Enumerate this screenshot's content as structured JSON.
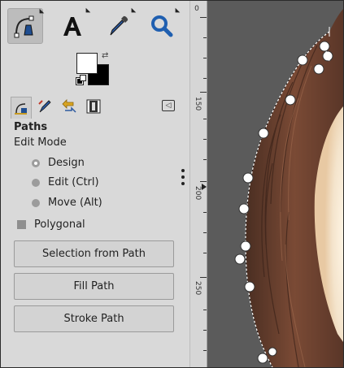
{
  "toolbox": {
    "tools": [
      {
        "name": "paths-tool-icon",
        "active": true
      },
      {
        "name": "text-tool-icon",
        "active": false
      },
      {
        "name": "color-picker-icon",
        "active": false
      },
      {
        "name": "zoom-tool-icon",
        "active": false
      }
    ],
    "foreground_color": "#ffffff",
    "background_color": "#000000"
  },
  "dock_tabs": [
    {
      "name": "tool-options-tab-icon",
      "active": true
    },
    {
      "name": "device-status-tab-icon",
      "active": false
    },
    {
      "name": "undo-history-tab-icon",
      "active": false
    },
    {
      "name": "images-tab-icon",
      "active": false
    }
  ],
  "tool_options": {
    "title": "Paths",
    "edit_mode_label": "Edit Mode",
    "modes": [
      {
        "label": "Design",
        "selected": true
      },
      {
        "label": "Edit (Ctrl)",
        "selected": false
      },
      {
        "label": "Move (Alt)",
        "selected": false
      }
    ],
    "polygonal_label": "Polygonal",
    "polygonal_checked": false,
    "buttons": {
      "selection_from_path": "Selection from Path",
      "fill_path": "Fill Path",
      "stroke_path": "Stroke Path"
    }
  },
  "ruler": {
    "labels": [
      "0",
      "150",
      "200",
      "250"
    ]
  },
  "colors": {
    "canvas_bg": "#5b5b5b",
    "panel_bg": "#d9d9d9",
    "path_anchor": "#ffffff"
  }
}
